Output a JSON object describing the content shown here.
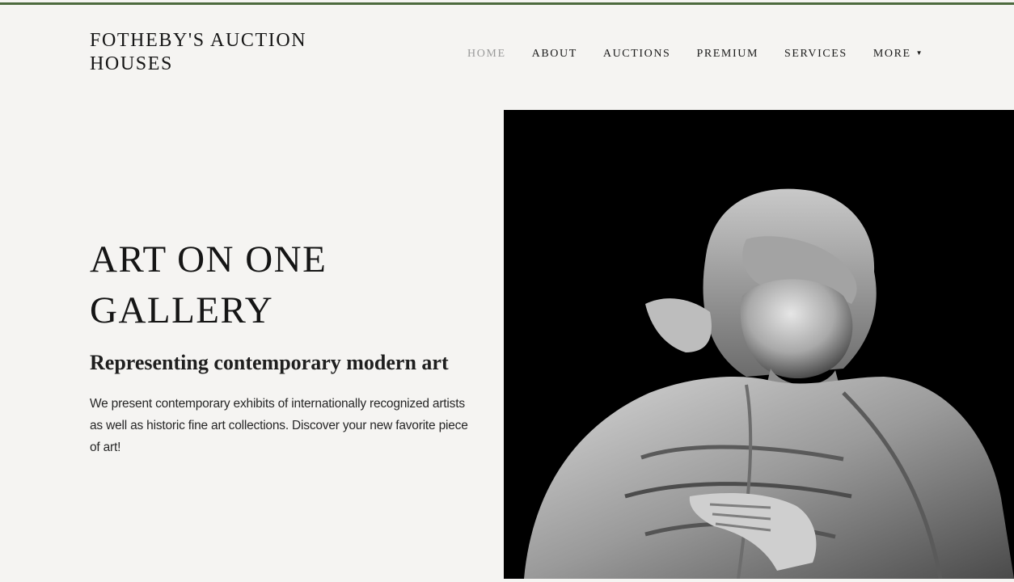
{
  "header": {
    "brand": "FOTHEBY'S AUCTION HOUSES",
    "accent_color": "#4d6a3e"
  },
  "nav": {
    "items": [
      {
        "label": "HOME",
        "active": true
      },
      {
        "label": "ABOUT"
      },
      {
        "label": "AUCTIONS"
      },
      {
        "label": "PREMIUM"
      },
      {
        "label": "SERVICES"
      },
      {
        "label": "MORE"
      }
    ],
    "more_icon": "caret-down-icon"
  },
  "hero": {
    "title_line1": "ART ON ONE",
    "title_line2": "GALLERY",
    "subtitle": "Representing contemporary modern art",
    "body": "We present contemporary exhibits of internationally recognized artists as well as historic fine art collections. Discover your new favorite piece of art!",
    "image_subject": "marble-statue"
  }
}
